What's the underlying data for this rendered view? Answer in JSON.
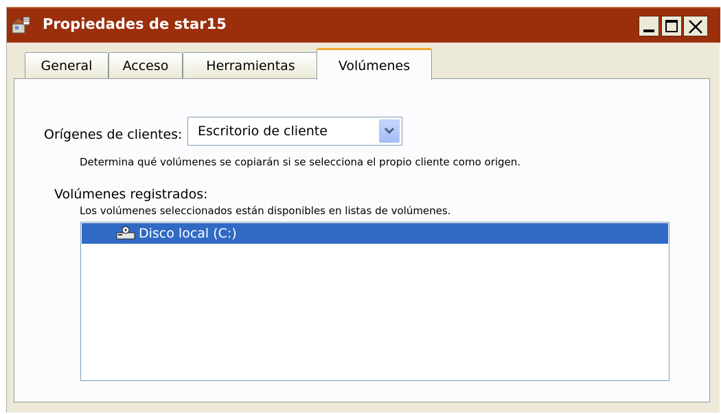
{
  "window": {
    "title": "Propiedades de star15",
    "icon": "server-properties-icon"
  },
  "title_buttons": {
    "minimize": "minimize-icon",
    "maximize": "maximize-icon",
    "close": "close-icon"
  },
  "tabs": [
    {
      "label": "General",
      "selected": false
    },
    {
      "label": "Acceso",
      "selected": false
    },
    {
      "label": "Herramientas",
      "selected": false
    },
    {
      "label": "Volúmenes",
      "selected": true
    }
  ],
  "client_sources": {
    "label": "Orígenes de clientes:",
    "selected_value": "Escritorio de cliente",
    "description": "Determina qué volúmenes se copiarán si se selecciona el propio cliente como origen."
  },
  "registered_volumes": {
    "label": "Volúmenes registrados:",
    "description": "Los volúmenes seleccionados están disponibles en listas de volúmenes.",
    "items": [
      {
        "label": "Disco local (C:)",
        "icon": "local-disk-icon",
        "selected": true
      }
    ]
  },
  "colors": {
    "titlebar": "#9b2e0b",
    "selection": "#316ac5",
    "tab_highlight": "#f0a830"
  }
}
